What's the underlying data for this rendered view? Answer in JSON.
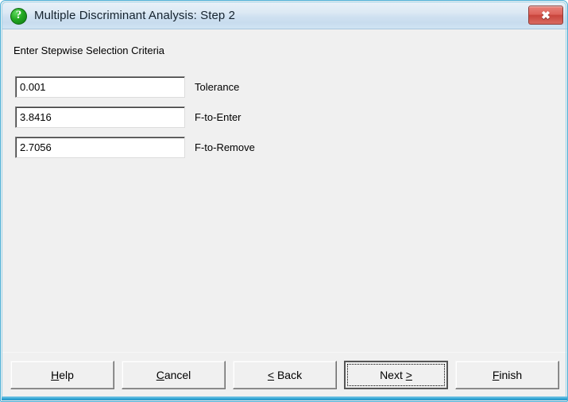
{
  "window": {
    "title": "Multiple Discriminant Analysis: Step 2",
    "icon": "question-mark-icon",
    "close_label": "✖",
    "accent_color": "#35a8d6",
    "titlebar_color": "#cfe1f1",
    "client_color": "#f0f0f0"
  },
  "content": {
    "heading": "Enter Stepwise Selection Criteria",
    "fields": [
      {
        "label": "Tolerance",
        "value": "0.001",
        "name": "tolerance"
      },
      {
        "label": "F-to-Enter",
        "value": "3.8416",
        "name": "f-to-enter"
      },
      {
        "label": "F-to-Remove",
        "value": "2.7056",
        "name": "f-to-remove"
      }
    ]
  },
  "buttons": {
    "help": {
      "pre": "",
      "mnemonic": "H",
      "post": "elp"
    },
    "cancel": {
      "pre": "",
      "mnemonic": "C",
      "post": "ancel"
    },
    "back": {
      "pre": "",
      "mnemonic": "<",
      "post": " Back"
    },
    "next": {
      "pre": "Next ",
      "mnemonic": ">",
      "post": ""
    },
    "finish": {
      "pre": "",
      "mnemonic": "F",
      "post": "inish"
    }
  }
}
